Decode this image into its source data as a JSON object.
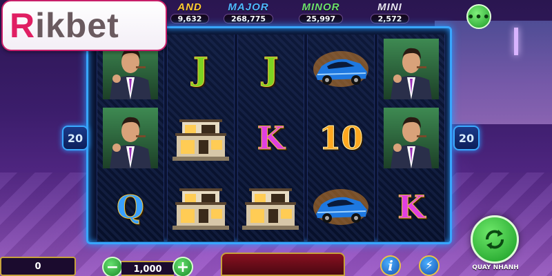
{
  "brand": {
    "logo_first": "R",
    "logo_rest": "ikbet"
  },
  "jackpots": [
    {
      "id": "grand",
      "title": "AND",
      "value": "9,632",
      "color": "#ffcc33"
    },
    {
      "id": "major",
      "title": "MAJOR",
      "value": "268,775",
      "color": "#4fb8ff"
    },
    {
      "id": "minor",
      "title": "MINOR",
      "value": "25,997",
      "color": "#6de06d"
    },
    {
      "id": "mini",
      "title": "MINI",
      "value": "2,572",
      "color": "#e8e4f4"
    }
  ],
  "menu_button": {
    "icon": "ellipsis-icon",
    "label": "•••"
  },
  "lines": {
    "left": "20",
    "right": "20"
  },
  "reels": [
    [
      "man",
      "man",
      "Q"
    ],
    [
      "J",
      "house",
      "house"
    ],
    [
      "J",
      "K",
      "house"
    ],
    [
      "car",
      "10",
      "car"
    ],
    [
      "man",
      "man",
      "K"
    ]
  ],
  "bottom_bar": {
    "win_value": "0",
    "bet_value": "1,000",
    "minus_label": "−",
    "plus_label": "+",
    "info_label": "i",
    "bolt_label": "⚡",
    "auto_label": "QUAY NHANH"
  },
  "colors": {
    "reel_border": "#38a6ff",
    "button_green": "#1d9a27",
    "brand_red": "#e01f63"
  }
}
